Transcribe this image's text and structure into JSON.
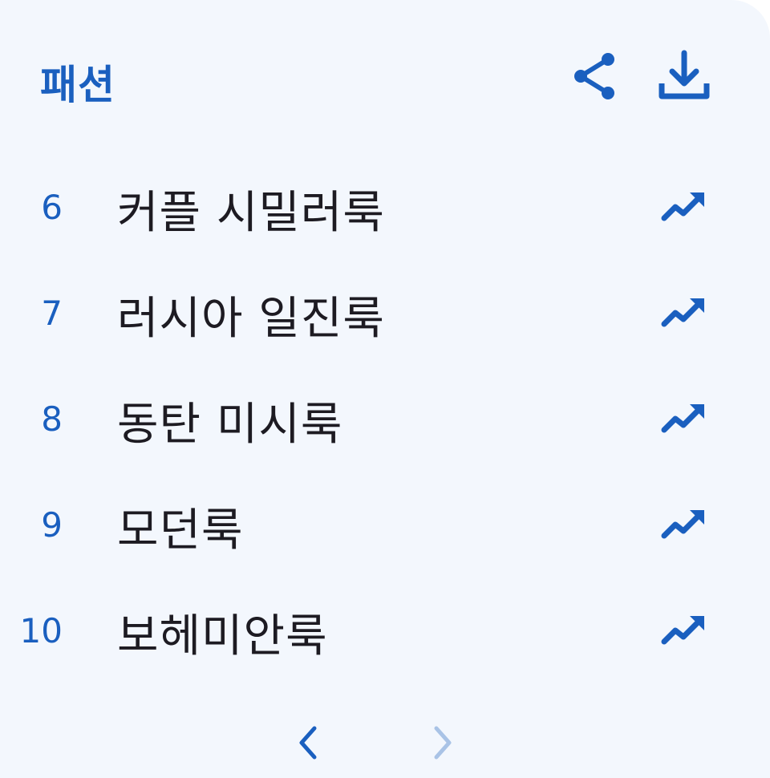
{
  "header": {
    "title": "패션",
    "share_icon": "share-icon",
    "download_icon": "download-icon"
  },
  "items": [
    {
      "rank": "6",
      "label": "커플 시밀러룩",
      "trend_icon": "trending-up-icon"
    },
    {
      "rank": "7",
      "label": "러시아 일진룩",
      "trend_icon": "trending-up-icon"
    },
    {
      "rank": "8",
      "label": "동탄 미시룩",
      "trend_icon": "trending-up-icon"
    },
    {
      "rank": "9",
      "label": "모던룩",
      "trend_icon": "trending-up-icon"
    },
    {
      "rank": "10",
      "label": "보헤미안룩",
      "trend_icon": "trending-up-icon"
    }
  ],
  "pager": {
    "prev_icon": "chevron-left-icon",
    "next_icon": "chevron-right-icon",
    "prev_enabled": true,
    "next_enabled": false
  },
  "colors": {
    "accent": "#1a5fbf",
    "text": "#1d1b22",
    "background": "#f3f7fd",
    "disabled": "#a9c3e6"
  }
}
